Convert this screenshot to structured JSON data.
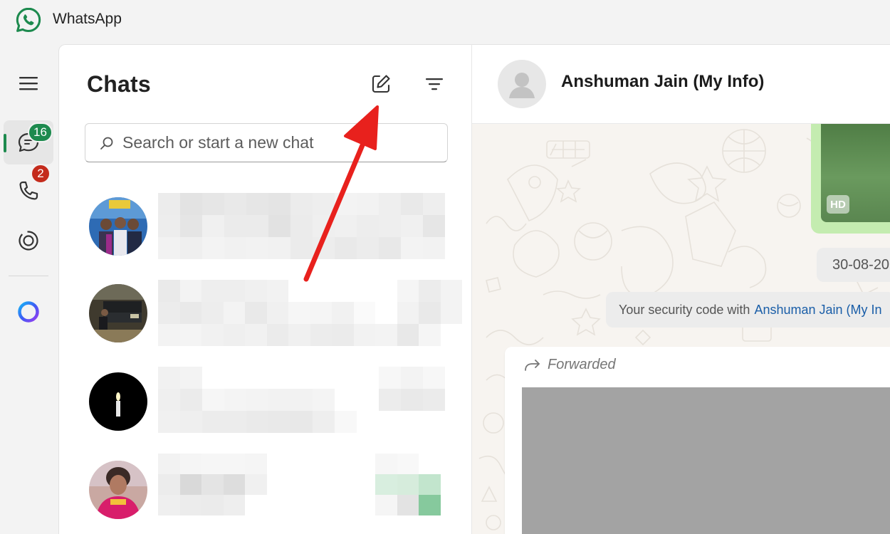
{
  "app": {
    "title": "WhatsApp"
  },
  "rail": {
    "chats_badge": "16",
    "calls_badge": "2"
  },
  "chats_panel": {
    "title": "Chats",
    "search": {
      "placeholder": "Search or start a new chat",
      "value": ""
    }
  },
  "conversation": {
    "contact_name": "Anshuman Jain (My Info)",
    "media_badge": "HD",
    "date_separator": "30-08-20",
    "security_notice": {
      "prefix": "Your security code with",
      "link": "Anshuman Jain (My In"
    },
    "forwarded_label": "Forwarded"
  },
  "colors": {
    "brand_green": "#1d8a4e",
    "badge_red": "#c42b1c",
    "annotation_arrow": "#e8211d",
    "sent_bubble": "#c4ecb0"
  },
  "icons": {
    "app_logo": "whatsapp-logo",
    "menu": "hamburger-icon",
    "chats": "chat-bubble-icon",
    "calls": "phone-icon",
    "status": "status-ring-icon",
    "meta_ai": "meta-ai-ring-icon",
    "new_chat": "new-chat-compose-icon",
    "filter": "filter-icon",
    "search": "search-icon",
    "forward": "forward-arrow-icon"
  }
}
